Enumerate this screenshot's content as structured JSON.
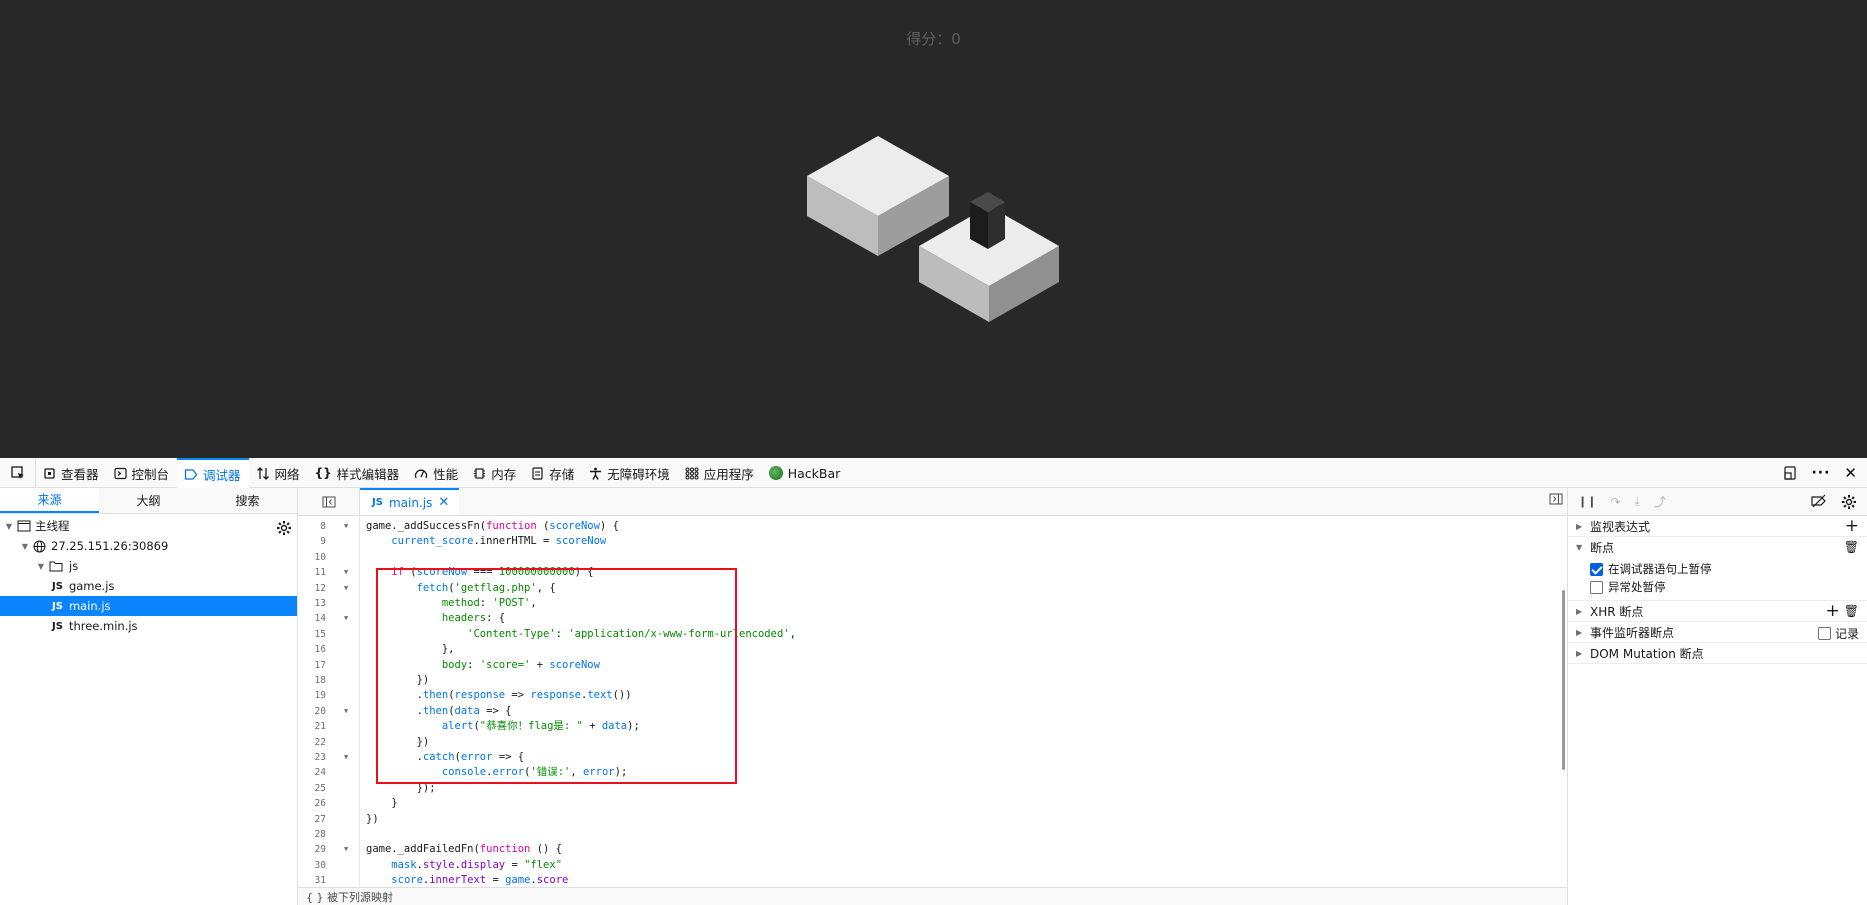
{
  "game": {
    "score_label": "得分：0"
  },
  "toolbar": {
    "tools": [
      {
        "label": "查看器",
        "icon": "inspector-icon"
      },
      {
        "label": "控制台",
        "icon": "console-icon"
      },
      {
        "label": "调试器",
        "icon": "debugger-icon",
        "active": true
      },
      {
        "label": "网络",
        "icon": "network-icon"
      },
      {
        "label": "样式编辑器",
        "icon": "style-editor-icon"
      },
      {
        "label": "性能",
        "icon": "performance-icon"
      },
      {
        "label": "内存",
        "icon": "memory-icon"
      },
      {
        "label": "存储",
        "icon": "storage-icon"
      },
      {
        "label": "无障碍环境",
        "icon": "accessibility-icon"
      },
      {
        "label": "应用程序",
        "icon": "application-icon"
      },
      {
        "label": "HackBar",
        "icon": "hackbar-icon"
      }
    ]
  },
  "sources": {
    "tabs": [
      "来源",
      "大纲",
      "搜索"
    ],
    "tree": {
      "thread": "主线程",
      "host": "27.25.151.26:30869",
      "folder": "js",
      "files": [
        "game.js",
        "main.js",
        "three.min.js"
      ],
      "selected": "main.js"
    }
  },
  "editor": {
    "tab_label": "main.js",
    "js_badge": "JS",
    "footer_text": "{ }   被下列源映射",
    "lines": [
      {
        "n": "8",
        "fold": true
      },
      {
        "n": "9"
      },
      {
        "n": "10"
      },
      {
        "n": "11",
        "fold": true
      },
      {
        "n": "12",
        "fold": true
      },
      {
        "n": "13"
      },
      {
        "n": "14",
        "fold": true
      },
      {
        "n": "15"
      },
      {
        "n": "16"
      },
      {
        "n": "17"
      },
      {
        "n": "18"
      },
      {
        "n": "19"
      },
      {
        "n": "20",
        "fold": true
      },
      {
        "n": "21"
      },
      {
        "n": "22"
      },
      {
        "n": "23",
        "fold": true
      },
      {
        "n": "24"
      },
      {
        "n": "25"
      },
      {
        "n": "26"
      },
      {
        "n": "27"
      },
      {
        "n": "28"
      },
      {
        "n": "29",
        "fold": true
      },
      {
        "n": "30"
      },
      {
        "n": "31"
      }
    ],
    "code": {
      "l8_a": "game._addSuccessFn(",
      "l8_b": "function",
      "l8_c": " (",
      "l8_d": "scoreNow",
      "l8_e": ") {",
      "l9_a": "    ",
      "l9_b": "current_score",
      "l9_c": ".innerHTML = ",
      "l9_d": "scoreNow",
      "l11_a": "    ",
      "l11_b": "if",
      "l11_c": " (",
      "l11_d": "scoreNow",
      "l11_e": " === ",
      "l11_f": "100000000000",
      "l11_g": ") {",
      "l12_a": "        ",
      "l12_b": "fetch",
      "l12_c": "(",
      "l12_d": "'getflag.php'",
      "l12_e": ", {",
      "l13_a": "            ",
      "l13_b": "method",
      "l13_c": ": ",
      "l13_d": "'POST'",
      "l13_e": ",",
      "l14_a": "            ",
      "l14_b": "headers",
      "l14_c": ": {",
      "l15_a": "                ",
      "l15_b": "'Content-Type'",
      "l15_c": ": ",
      "l15_d": "'application/x-www-form-urlencoded'",
      "l15_e": ",",
      "l16": "            },",
      "l17_a": "            ",
      "l17_b": "body",
      "l17_c": ": ",
      "l17_d": "'score='",
      "l17_e": " + ",
      "l17_f": "scoreNow",
      "l18": "        })",
      "l19_a": "        .",
      "l19_b": "then",
      "l19_c": "(",
      "l19_d": "response",
      "l19_e": " => ",
      "l19_f": "response",
      "l19_g": ".",
      "l19_h": "text",
      "l19_i": "())",
      "l20_a": "        .",
      "l20_b": "then",
      "l20_c": "(",
      "l20_d": "data",
      "l20_e": " => {",
      "l21_a": "            ",
      "l21_b": "alert",
      "l21_c": "(",
      "l21_d": "\"恭喜你！flag是: \"",
      "l21_e": " + ",
      "l21_f": "data",
      "l21_g": ");",
      "l22": "        })",
      "l23_a": "        .",
      "l23_b": "catch",
      "l23_c": "(",
      "l23_d": "error",
      "l23_e": " => {",
      "l24_a": "            ",
      "l24_b": "console",
      "l24_c": ".",
      "l24_d": "error",
      "l24_e": "(",
      "l24_f": "'错误:'",
      "l24_g": ", ",
      "l24_h": "error",
      "l24_i": ");",
      "l25": "        });",
      "l26": "    }",
      "l27": "})",
      "l29_a": "game._addFailedFn(",
      "l29_b": "function",
      "l29_c": " () {",
      "l30_a": "    ",
      "l30_b": "mask",
      "l30_c": ".",
      "l30_d": "style",
      "l30_e": ".",
      "l30_f": "display",
      "l30_g": " = ",
      "l30_h": "\"flex\"",
      "l31_a": "    ",
      "l31_b": "score",
      "l31_c": ".",
      "l31_d": "innerText",
      "l31_e": " = ",
      "l31_f": "game",
      "l31_g": ".",
      "l31_h": "score"
    }
  },
  "debugger": {
    "watch": "监视表达式",
    "breakpoints": "断点",
    "pause_on_debugger": "在调试器语句上暂停",
    "pause_on_debugger_checked": true,
    "pause_on_exceptions": "异常处暂停",
    "pause_on_exceptions_checked": false,
    "xhr": "XHR 断点",
    "event_listeners": "事件监听器断点",
    "log": "记录",
    "dom_mutation": "DOM Mutation 断点"
  },
  "colors": {
    "game_bg": "#282828",
    "accent": "#0a84ff",
    "highlight_box": "#e8101c"
  }
}
